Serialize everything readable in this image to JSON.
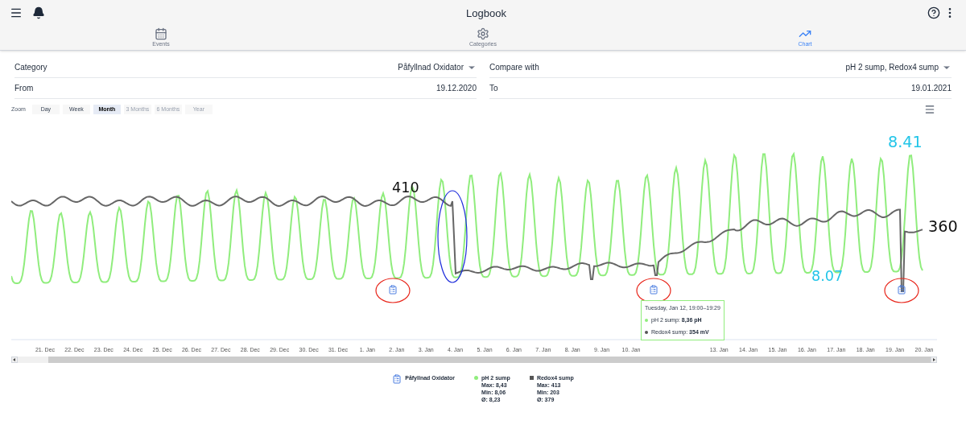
{
  "header": {
    "title": "Logbook"
  },
  "tabs": [
    {
      "label": "Events",
      "kind": "calendar",
      "selected": false
    },
    {
      "label": "Categories",
      "kind": "gear",
      "selected": false
    },
    {
      "label": "Chart",
      "kind": "trend",
      "selected": true
    }
  ],
  "filters": [
    {
      "label": "Category",
      "value": "Påfyllnad Oxidator",
      "kind": "dropdown"
    },
    {
      "label": "Compare with",
      "value": "pH 2 sump, Redox4 sump",
      "kind": "dropdown"
    },
    {
      "label": "From",
      "value": "19.12.2020",
      "kind": "date"
    },
    {
      "label": "To",
      "value": "19.01.2021",
      "kind": "date"
    }
  ],
  "zoom": {
    "label": "Zoom",
    "options": [
      {
        "label": "Day",
        "selected": false,
        "disabled": false
      },
      {
        "label": "Week",
        "selected": false,
        "disabled": false
      },
      {
        "label": "Month",
        "selected": true,
        "disabled": false
      },
      {
        "label": "3 Months",
        "selected": false,
        "disabled": true
      },
      {
        "label": "6 Months",
        "selected": false,
        "disabled": true
      },
      {
        "label": "Year",
        "selected": false,
        "disabled": true
      }
    ]
  },
  "chart": {
    "x_labels": [
      "21. Dec",
      "22. Dec",
      "23. Dec",
      "24. Dec",
      "25. Dec",
      "26. Dec",
      "27. Dec",
      "28. Dec",
      "29. Dec",
      "30. Dec",
      "31. Dec",
      "1. Jan",
      "2. Jan",
      "3. Jan",
      "4. Jan",
      "5. Jan",
      "6. Jan",
      "7. Jan",
      "8. Jan",
      "9. Jan",
      "10. Jan",
      "13. Jan",
      "14. Jan",
      "15. Jan",
      "16. Jan",
      "17. Jan",
      "18. Jan",
      "19. Jan",
      "20. Jan"
    ],
    "tooltip": {
      "time": "Tuesday, Jan 12, 19:00–19:29",
      "series": [
        {
          "text": "pH 2 sump: **8,36 pH**",
          "color": "#90ed7d"
        },
        {
          "text": "Redox4 sump: **354 mV**",
          "color": "#555555"
        }
      ]
    },
    "annotations": [
      {
        "text": "410",
        "color": "#111111"
      },
      {
        "text": "360",
        "color": "#111111"
      },
      {
        "text": "8.41",
        "color": "#22c5e8"
      },
      {
        "text": "8.07",
        "color": "#22c5e8"
      }
    ]
  },
  "legend": [
    {
      "name": "Påfyllnad Oxidator",
      "kind": "event"
    },
    {
      "name": "pH 2 sump",
      "kind": "series",
      "color": "#90ed7d",
      "stats": [
        "Max: 8,43",
        "Min: 8,06",
        "Ø: 8,23"
      ]
    },
    {
      "name": "Redox4 sump",
      "kind": "series",
      "color": "#555555",
      "stats": [
        "Max: 413",
        "Min: 203",
        "Ø: 379"
      ]
    }
  ]
}
